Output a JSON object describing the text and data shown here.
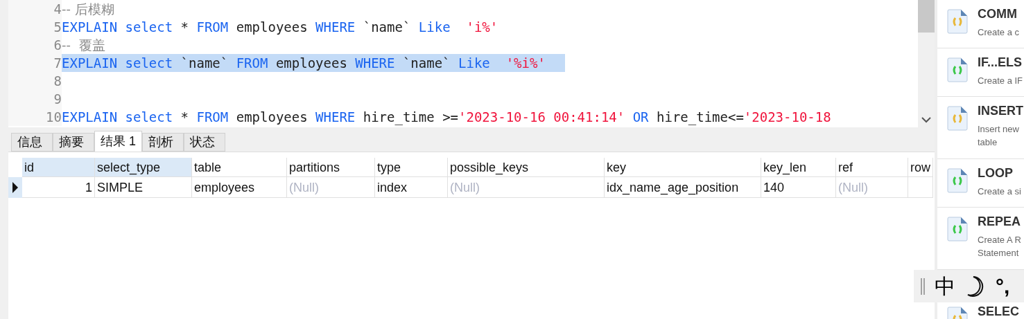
{
  "editor": {
    "lines": [
      {
        "number": "4",
        "selected": false,
        "tokens": [
          {
            "kind": "comment",
            "text": "-- 后模糊"
          }
        ]
      },
      {
        "number": "5",
        "selected": false,
        "tokens": [
          {
            "kind": "keyword",
            "text": "EXPLAIN"
          },
          {
            "kind": "keyword",
            "text": " select"
          },
          {
            "kind": "plain",
            "text": " * "
          },
          {
            "kind": "keyword",
            "text": "FROM"
          },
          {
            "kind": "plain",
            "text": " employees "
          },
          {
            "kind": "keyword",
            "text": "WHERE"
          },
          {
            "kind": "plain",
            "text": " `name` "
          },
          {
            "kind": "keyword",
            "text": "Like"
          },
          {
            "kind": "string",
            "text": "  'i%'"
          }
        ]
      },
      {
        "number": "6",
        "selected": false,
        "tokens": [
          {
            "kind": "comment",
            "text": "--  覆盖"
          }
        ]
      },
      {
        "number": "7",
        "selected": true,
        "tokens": [
          {
            "kind": "keyword",
            "text": "EXPLAIN"
          },
          {
            "kind": "keyword",
            "text": " select"
          },
          {
            "kind": "plain",
            "text": " `name` "
          },
          {
            "kind": "keyword",
            "text": "FROM"
          },
          {
            "kind": "plain",
            "text": " employees "
          },
          {
            "kind": "keyword",
            "text": "WHERE"
          },
          {
            "kind": "plain",
            "text": " `name` "
          },
          {
            "kind": "keyword",
            "text": "Like"
          },
          {
            "kind": "string",
            "text": "  '%i%'"
          }
        ]
      },
      {
        "number": "8"
      },
      {
        "number": "9"
      },
      {
        "number": "10",
        "selected": false,
        "tokens": [
          {
            "kind": "keyword",
            "text": "EXPLAIN"
          },
          {
            "kind": "keyword",
            "text": " select"
          },
          {
            "kind": "plain",
            "text": " * "
          },
          {
            "kind": "keyword",
            "text": "FROM"
          },
          {
            "kind": "plain",
            "text": " employees "
          },
          {
            "kind": "keyword",
            "text": "WHERE"
          },
          {
            "kind": "plain",
            "text": " hire_time >="
          },
          {
            "kind": "string",
            "text": "'2023-10-16 00:41:14'"
          },
          {
            "kind": "keyword",
            "text": " OR"
          },
          {
            "kind": "plain",
            "text": " hire_time<="
          },
          {
            "kind": "string",
            "text": "'2023-10-18"
          }
        ]
      }
    ]
  },
  "tabs": [
    {
      "label": "信息",
      "selected": false
    },
    {
      "label": "摘要",
      "selected": false
    },
    {
      "label": "结果 1",
      "selected": true
    },
    {
      "label": "剖析",
      "selected": false
    },
    {
      "label": "状态",
      "selected": false
    }
  ],
  "table": {
    "columns": [
      {
        "label": "id",
        "selected": true,
        "kind": "id"
      },
      {
        "label": "select_type",
        "selected": true,
        "kind": "text"
      },
      {
        "label": "table",
        "selected": false,
        "kind": "text"
      },
      {
        "label": "partitions",
        "selected": false,
        "kind": "text"
      },
      {
        "label": "type",
        "selected": false,
        "kind": "text"
      },
      {
        "label": "possible_keys",
        "selected": false,
        "kind": "text"
      },
      {
        "label": "key",
        "selected": false,
        "kind": "text"
      },
      {
        "label": "key_len",
        "selected": false,
        "kind": "text"
      },
      {
        "label": "ref",
        "selected": false,
        "kind": "text"
      },
      {
        "label": "row",
        "selected": false,
        "kind": "text"
      }
    ],
    "rows": [
      {
        "current": true,
        "cells": [
          {
            "text": "1",
            "null": false
          },
          {
            "text": "SIMPLE",
            "null": false
          },
          {
            "text": "employees",
            "null": false
          },
          {
            "text": "(Null)",
            "null": true
          },
          {
            "text": "index",
            "null": false
          },
          {
            "text": "(Null)",
            "null": true
          },
          {
            "text": "idx_name_age_position",
            "null": false
          },
          {
            "text": "140",
            "null": false
          },
          {
            "text": "(Null)",
            "null": true
          }
        ]
      }
    ]
  },
  "snippets": [
    {
      "title": "COMM",
      "description": [
        "Create a c"
      ],
      "color": "#e8b83a"
    },
    {
      "title": "IF...ELS",
      "description": [
        "Create a IF"
      ],
      "color": "#3cc84a"
    },
    {
      "title": "INSERT",
      "description": [
        "Insert new",
        "table"
      ],
      "color": "#e8b83a"
    },
    {
      "title": "LOOP",
      "description": [
        "Create a si"
      ],
      "color": "#3cc84a"
    },
    {
      "title": "REPEA",
      "description": [
        "Create A R",
        "Statement"
      ],
      "color": "#3cc84a"
    },
    {
      "title": "SELEC",
      "color": "#e8b83a"
    }
  ],
  "ime_toolbar": {
    "mode": "中",
    "punctuation": "°,"
  }
}
